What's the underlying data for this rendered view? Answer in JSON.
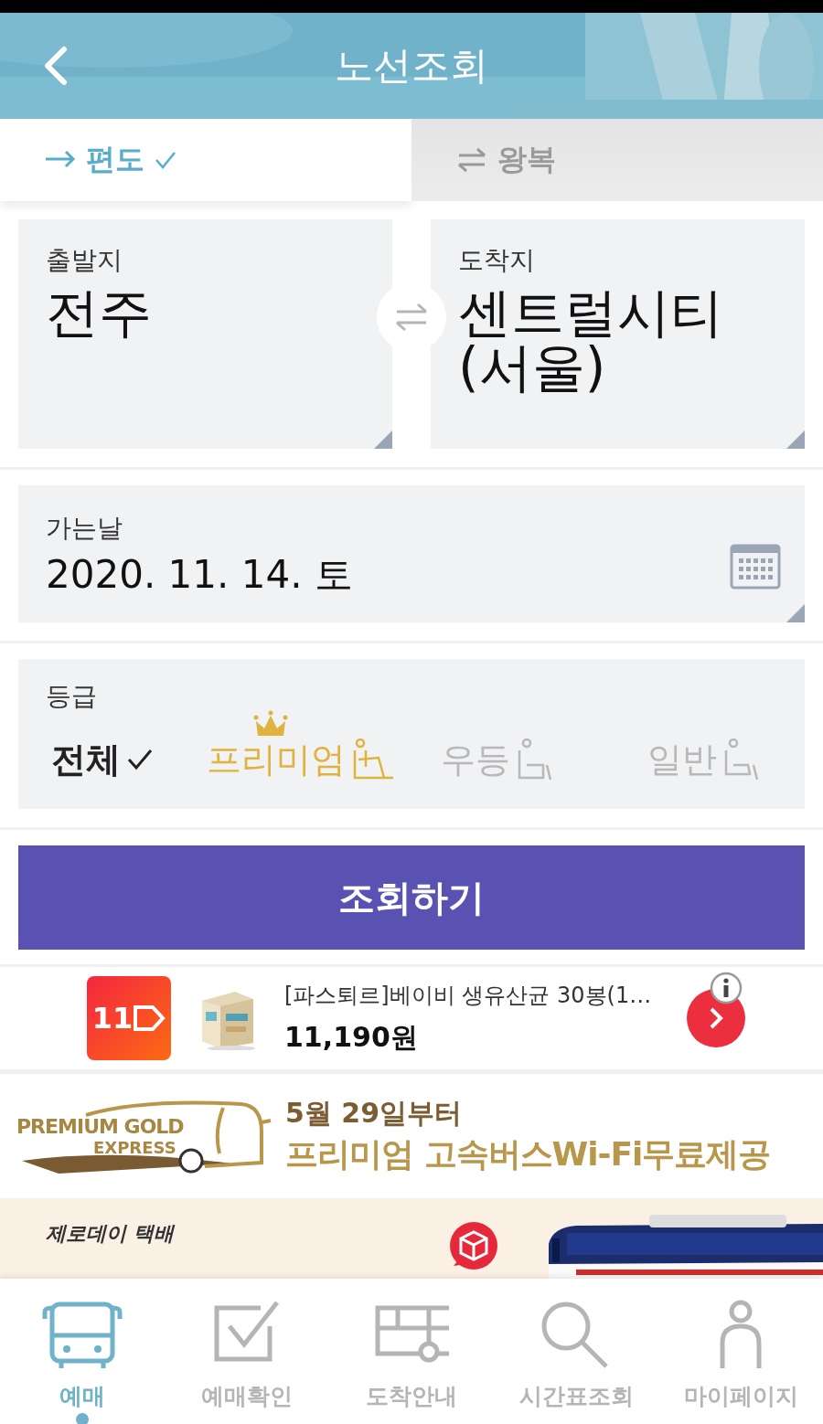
{
  "header": {
    "title": "노선조회"
  },
  "trip_tabs": [
    {
      "label": "편도",
      "kind": "oneway",
      "selected": true
    },
    {
      "label": "왕복",
      "kind": "round",
      "selected": false
    }
  ],
  "departure": {
    "label": "출발지",
    "value_lines": [
      "전주"
    ]
  },
  "arrival": {
    "label": "도착지",
    "value_lines": [
      "센트럴시티",
      "(서울)"
    ]
  },
  "date": {
    "label": "가는날",
    "value": "2020. 11. 14. 토"
  },
  "grade": {
    "label": "등급",
    "options": [
      {
        "label": "전체",
        "kind": "all",
        "selected": true
      },
      {
        "label": "프리미엄",
        "kind": "premium",
        "selected": false
      },
      {
        "label": "우등",
        "kind": "deluxe",
        "selected": false
      },
      {
        "label": "일반",
        "kind": "standard",
        "selected": false
      }
    ]
  },
  "search_button": "조회하기",
  "ad": {
    "logo": "11",
    "title": "[파스퇴르]베이비 생유산균 30봉(1…",
    "price": "11,190원"
  },
  "promo_banner": {
    "brand": "PREMIUM GOLD",
    "brand_sub": "EXPRESS",
    "line1": "5월 29일부터",
    "line2": "프리미엄 고속버스Wi-Fi무료제공"
  },
  "delivery_banner": {
    "line1": "제로데이 택배"
  },
  "nav": [
    {
      "label": "예매",
      "kind": "bus",
      "selected": true
    },
    {
      "label": "예매확인",
      "kind": "check",
      "selected": false
    },
    {
      "label": "도착안내",
      "kind": "arrival",
      "selected": false
    },
    {
      "label": "시간표조회",
      "kind": "search",
      "selected": false
    },
    {
      "label": "마이페이지",
      "kind": "person",
      "selected": false
    }
  ]
}
